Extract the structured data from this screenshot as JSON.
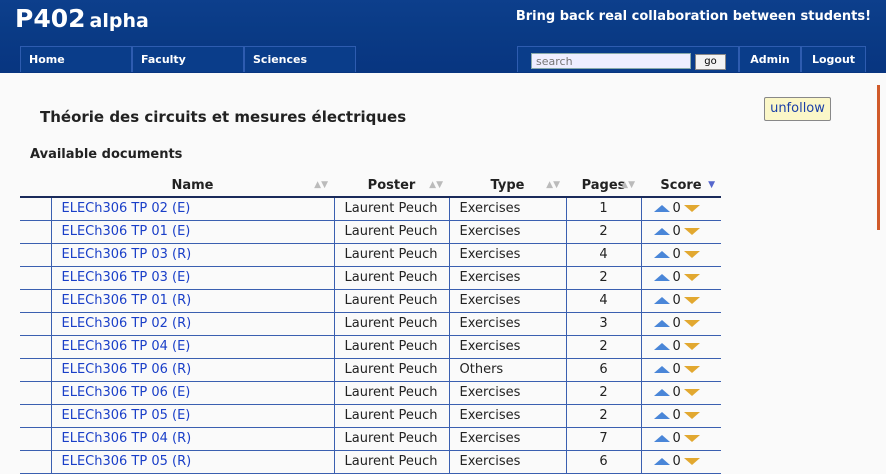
{
  "brand": {
    "main": "P402",
    "sub": "alpha",
    "tagline": "Bring back real collaboration between students!"
  },
  "nav": {
    "home": "Home",
    "faculty": "Faculty",
    "sciences": "Sciences",
    "admin": "Admin",
    "logout": "Logout"
  },
  "search": {
    "placeholder": "search",
    "go_label": "go"
  },
  "course": {
    "title": "Théorie des circuits et mesures électriques",
    "follow_label": "unfollow"
  },
  "documents": {
    "section_title": "Available documents",
    "columns": [
      "Name",
      "Poster",
      "Type",
      "Pages",
      "Score"
    ],
    "rows": [
      {
        "name": "ELECh306 TP 02 (E)",
        "poster": "Laurent Peuch",
        "type": "Exercises",
        "pages": "1",
        "score": "0"
      },
      {
        "name": "ELECh306 TP 01 (E)",
        "poster": "Laurent Peuch",
        "type": "Exercises",
        "pages": "2",
        "score": "0"
      },
      {
        "name": "ELECh306 TP 03 (R)",
        "poster": "Laurent Peuch",
        "type": "Exercises",
        "pages": "4",
        "score": "0"
      },
      {
        "name": "ELECh306 TP 03 (E)",
        "poster": "Laurent Peuch",
        "type": "Exercises",
        "pages": "2",
        "score": "0"
      },
      {
        "name": "ELECh306 TP 01 (R)",
        "poster": "Laurent Peuch",
        "type": "Exercises",
        "pages": "4",
        "score": "0"
      },
      {
        "name": "ELECh306 TP 02 (R)",
        "poster": "Laurent Peuch",
        "type": "Exercises",
        "pages": "3",
        "score": "0"
      },
      {
        "name": "ELECh306 TP 04 (E)",
        "poster": "Laurent Peuch",
        "type": "Exercises",
        "pages": "2",
        "score": "0"
      },
      {
        "name": "ELECh306 TP 06 (R)",
        "poster": "Laurent Peuch",
        "type": "Others",
        "pages": "6",
        "score": "0"
      },
      {
        "name": "ELECh306 TP 06 (E)",
        "poster": "Laurent Peuch",
        "type": "Exercises",
        "pages": "2",
        "score": "0"
      },
      {
        "name": "ELECh306 TP 05 (E)",
        "poster": "Laurent Peuch",
        "type": "Exercises",
        "pages": "2",
        "score": "0"
      },
      {
        "name": "ELECh306 TP 04 (R)",
        "poster": "Laurent Peuch",
        "type": "Exercises",
        "pages": "7",
        "score": "0"
      },
      {
        "name": "ELECh306 TP 05 (R)",
        "poster": "Laurent Peuch",
        "type": "Exercises",
        "pages": "6",
        "score": "0"
      }
    ]
  }
}
